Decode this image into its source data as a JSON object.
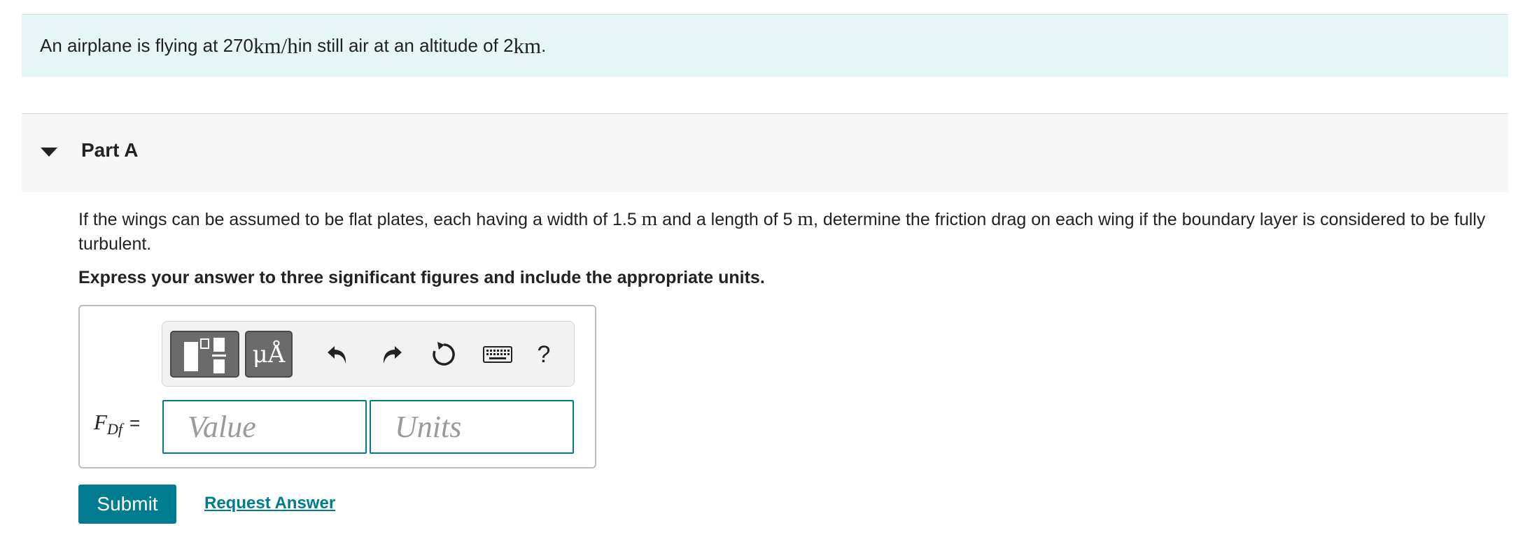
{
  "intro": {
    "t1": "An airplane is flying at 270 ",
    "m1": "km/h",
    "t2": " in still air at an altitude of 2 ",
    "m2": "km",
    "t3": "."
  },
  "part": {
    "title": "Part A"
  },
  "question": {
    "t1": "If the wings can be assumed to be flat plates, each having a width of 1.5 ",
    "m1": "m",
    "t2": " and a length of 5 ",
    "m2": "m",
    "t3": ", determine the friction drag on each wing if the boundary layer is considered to be fully turbulent."
  },
  "instruction": "Express your answer to three significant figures and include the appropriate units.",
  "toolbar": {
    "symbols_label": "μÅ",
    "help_label": "?"
  },
  "answer": {
    "var_main": "F",
    "var_sub": "Df",
    "equals": "=",
    "value_placeholder": "Value",
    "units_placeholder": "Units"
  },
  "actions": {
    "submit_label": "Submit",
    "request_label": "Request Answer"
  },
  "colors": {
    "accent": "#007c91",
    "intro_bg": "#e6f6f6",
    "part_bg": "#f6f6f6"
  }
}
